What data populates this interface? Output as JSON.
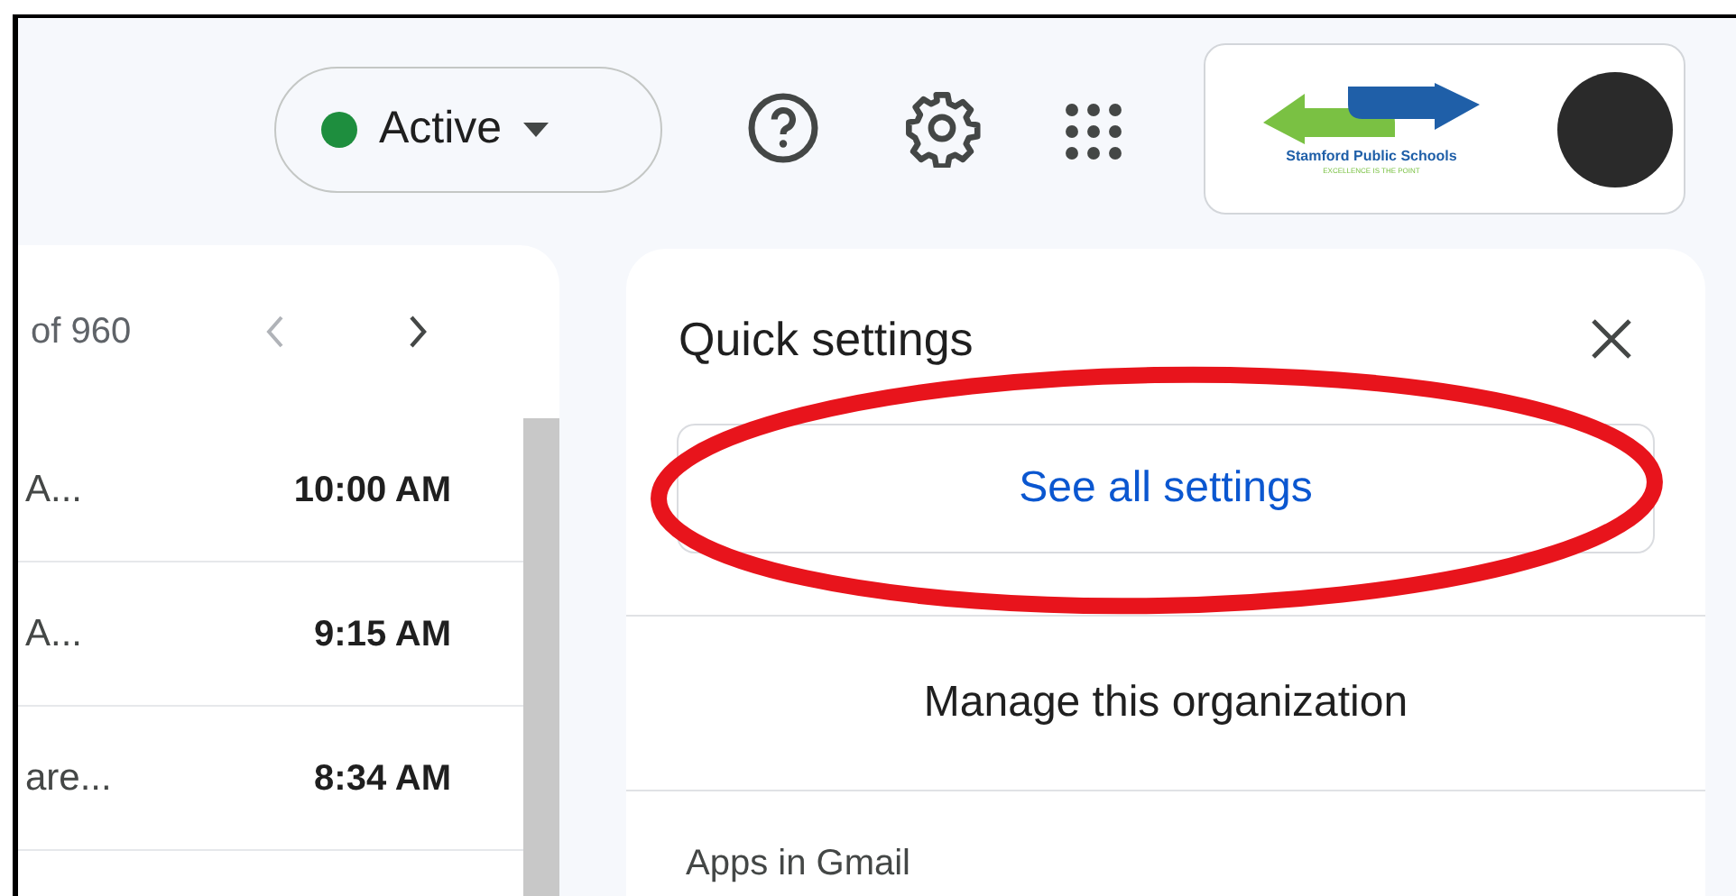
{
  "status": {
    "label": "Active",
    "online": true
  },
  "account": {
    "org_name": "Stamford Public Schools",
    "org_tagline": "EXCELLENCE IS THE POINT"
  },
  "mail_list": {
    "range": "of 960",
    "rows": [
      {
        "snippet": "A...",
        "time": "10:00 AM"
      },
      {
        "snippet": "A...",
        "time": "9:15 AM"
      },
      {
        "snippet": "are...",
        "time": "8:34 AM"
      }
    ]
  },
  "quick_settings": {
    "title": "Quick settings",
    "see_all": "See all settings",
    "manage": "Manage this organization",
    "section": "Apps in Gmail"
  }
}
